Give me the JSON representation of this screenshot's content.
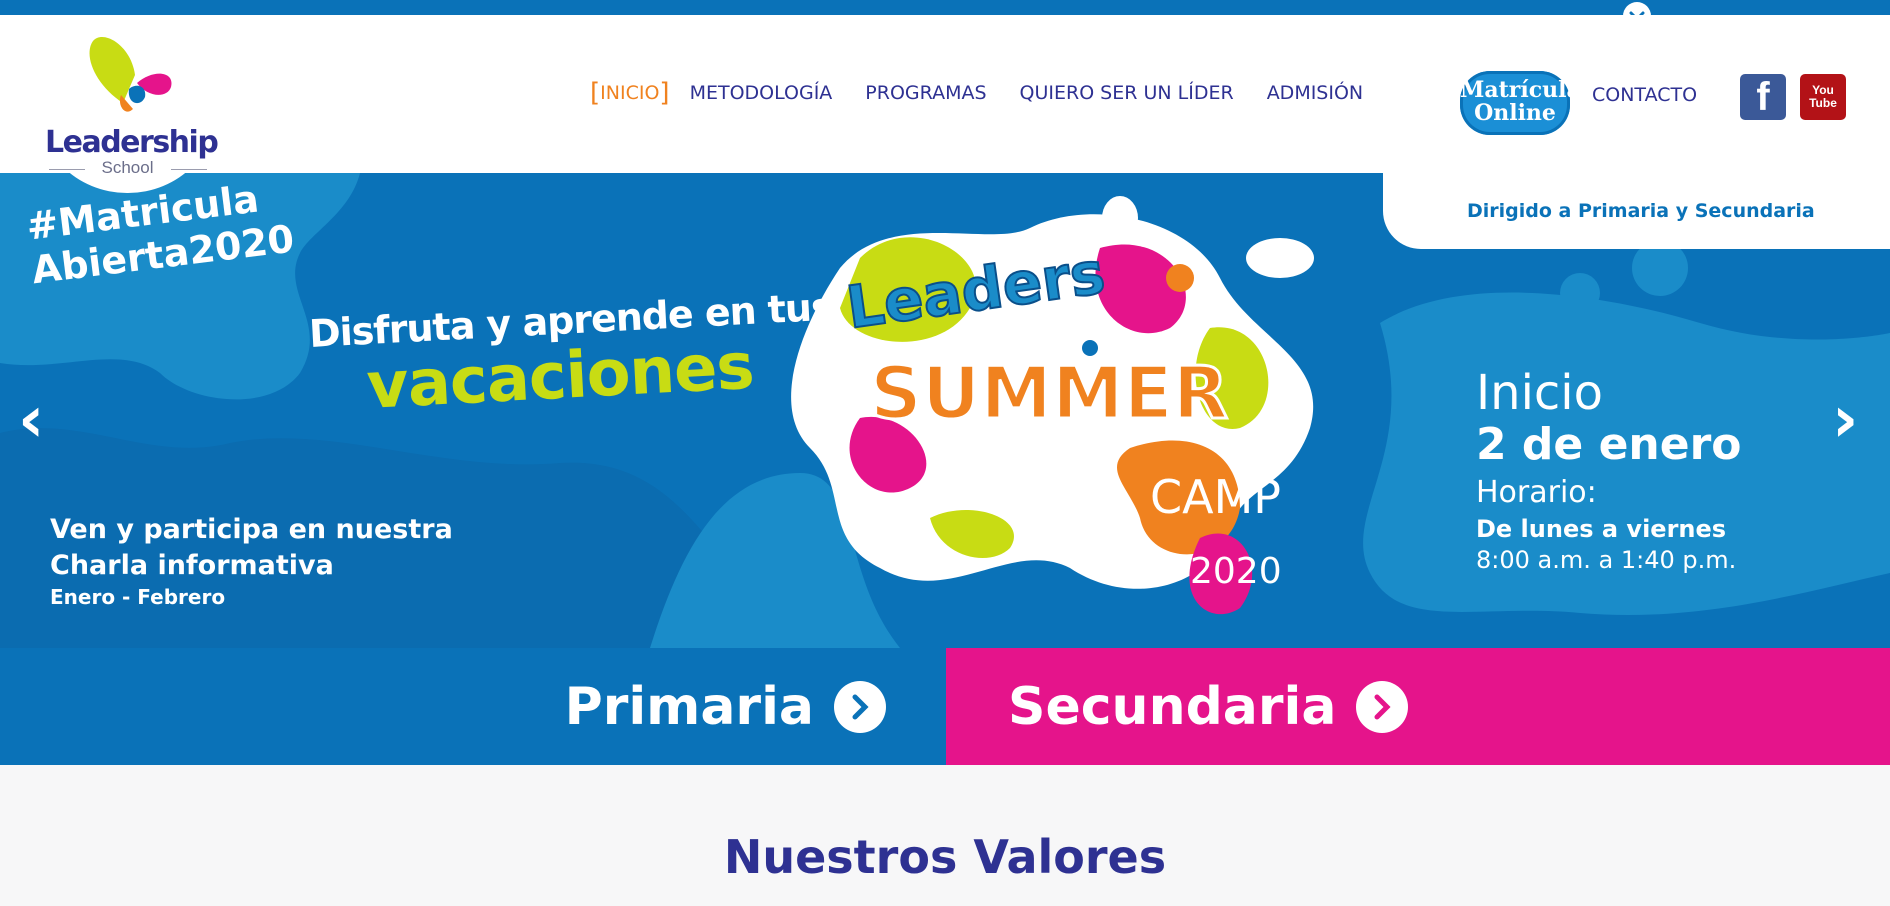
{
  "brand": {
    "name": "Leadership",
    "sub": "School"
  },
  "nav": {
    "items": [
      "INICIO",
      "METODOLOGÍA",
      "PROGRAMAS",
      "QUIERO SER UN LÍDER",
      "ADMISIÓN"
    ],
    "matricula_line1": "Matrícula",
    "matricula_line2": "Online",
    "contacto": "CONTACTO",
    "facebook_glyph": "f",
    "youtube_line1": "You",
    "youtube_line2": "Tube"
  },
  "hero": {
    "pill": "Dirigido a Primaria y Secundaria",
    "hashtag_line1": "#Matricula",
    "hashtag_line2": "Abierta2020",
    "disfruta": "Disfruta y aprende en tus",
    "vacaciones": "vacaciones",
    "charla_line1": "Ven y participa en nuestra",
    "charla_line2": "Charla informativa",
    "charla_line3": "Enero - Febrero",
    "camp_leaders": "Leaders",
    "camp_summer": "SUMMER",
    "camp_camp": "CAMP",
    "camp_year": "2020",
    "inicio_label": "Inicio",
    "inicio_date": "2 de enero",
    "horario_label": "Horario:",
    "horario_days": "De lunes a viernes",
    "horario_time": "8:00 a.m. a 1:40 p.m."
  },
  "bands": {
    "primaria": "Primaria",
    "secundaria": "Secundaria"
  },
  "section": {
    "title": "Nuestros Valores"
  },
  "colors": {
    "primary_blue": "#0a72b8",
    "navy": "#2e3192",
    "orange": "#f0821f",
    "pink": "#e5148b",
    "lime": "#c8dc14"
  },
  "icons": [
    "chevron-down-icon",
    "facebook-icon",
    "youtube-icon",
    "arrow-left-icon",
    "arrow-right-icon",
    "circle-arrow-icon"
  ]
}
